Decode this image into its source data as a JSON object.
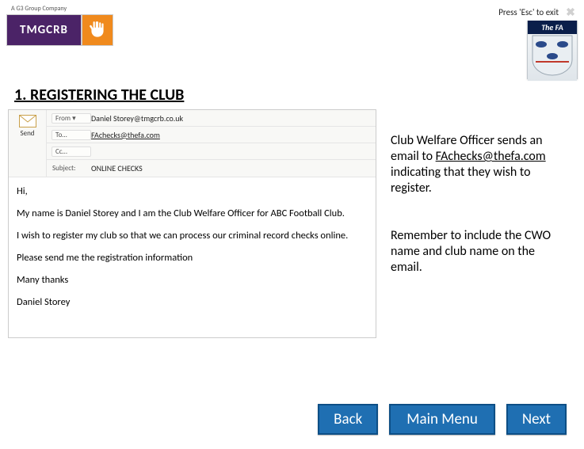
{
  "header": {
    "logo_tagline": "A G3 Group Company",
    "logo_text": "TMGCRB",
    "exit_hint": "Press 'Esc' to exit",
    "fa_banner": "The FA"
  },
  "heading": "1. REGISTERING THE CLUB",
  "email": {
    "send_label": "Send",
    "from_label": "From ▾",
    "from_value": "Daniel Storey@tmgcrb.co.uk",
    "to_label": "To…",
    "to_value": "FAchecks@thefa.com",
    "cc_label": "Cc…",
    "cc_value": "",
    "subject_label": "Subject:",
    "subject_value": "ONLINE CHECKS",
    "body": {
      "line1": "Hi,",
      "line2": "My name is Daniel Storey and I am the Club Welfare Officer for ABC Football Club.",
      "line3": "I wish to register my club so that we can process our criminal record checks online.",
      "line4": "Please send me the registration information",
      "line5": "Many thanks",
      "line6": "Daniel Storey"
    }
  },
  "info": {
    "block1_pre": "Club Welfare Officer sends an email to ",
    "block1_link": "FAchecks@thefa.com",
    "block1_post": " indicating that they wish to register.",
    "block2": "Remember to include the CWO name and club name on the email."
  },
  "buttons": {
    "back": "Back",
    "menu": "Main Menu",
    "next": "Next"
  }
}
